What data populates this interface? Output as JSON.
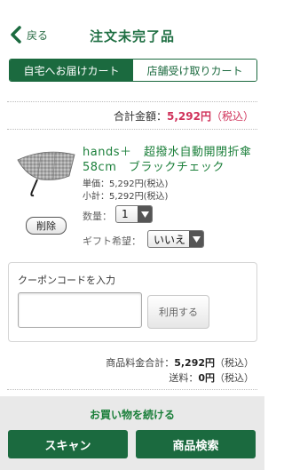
{
  "header": {
    "back_label": "戻る",
    "title": "注文未完了品"
  },
  "tabs": [
    {
      "label": "自宅へお届けカート",
      "active": true
    },
    {
      "label": "店舗受け取りカート",
      "active": false
    }
  ],
  "total": {
    "label": "合計金額：",
    "amount": "5,292円",
    "tax": "（税込）"
  },
  "product": {
    "name_line1": "hands＋　超撥水自動開閉折傘",
    "name_line2": "58cm　ブラックチェック",
    "unit_price": "単価：5,292円(税込)",
    "subtotal": "小計：5,292円(税込)",
    "qty_label": "数量：",
    "qty_value": "1",
    "gift_label": "ギフト希望：",
    "gift_value": "いいえ",
    "delete_label": "削除"
  },
  "coupon": {
    "title": "クーポンコードを入力",
    "input_value": "",
    "button_label": "利用する"
  },
  "summary": {
    "goods_label": "商品料金合計：",
    "goods_amount": "5,292円",
    "goods_tax": "（税込）",
    "shipping_label": "送料：",
    "shipping_amount": "0円",
    "shipping_tax": "（税込）"
  },
  "bottom": {
    "continue_label": "お買い物を続ける",
    "scan_label": "スキャン",
    "search_label": "商品検索"
  },
  "colors": {
    "brand_green": "#1b6a3f",
    "price_pink": "#d0325a",
    "product_name": "#1b7f3a"
  }
}
